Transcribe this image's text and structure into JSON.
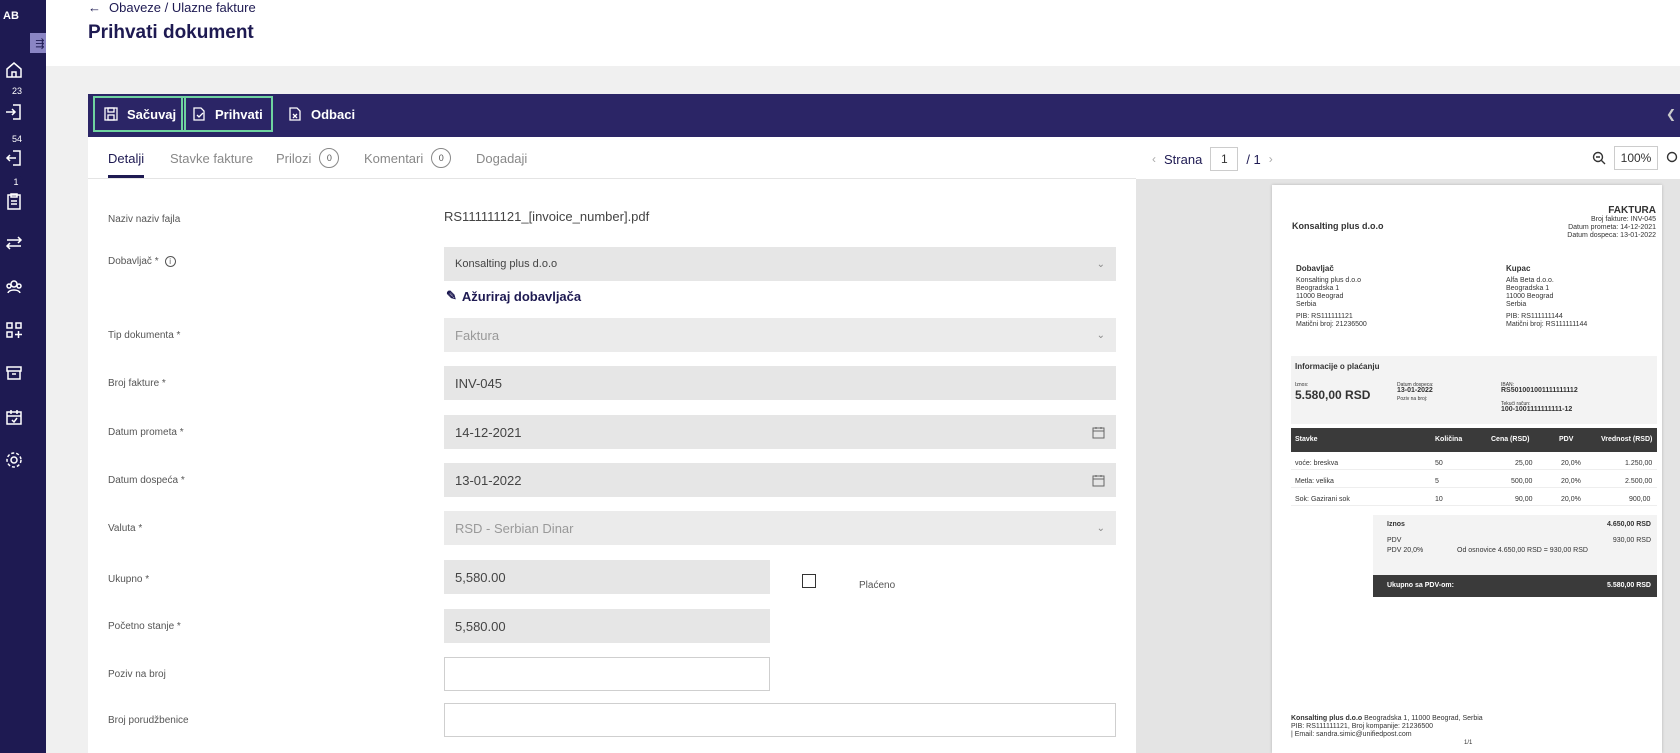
{
  "sidebar": {
    "avatar": "AB",
    "toggle_icon": "collapse-icon",
    "items": [
      {
        "name": "home-icon",
        "badge": ""
      },
      {
        "name": "inbox-incoming-icon",
        "badge": "23"
      },
      {
        "name": "outgoing-icon",
        "badge": "54"
      },
      {
        "name": "clipboard-icon",
        "badge": "1"
      },
      {
        "name": "transfer-icon",
        "badge": ""
      },
      {
        "name": "users-icon",
        "badge": ""
      },
      {
        "name": "apps-add-icon",
        "badge": ""
      },
      {
        "name": "archive-icon",
        "badge": ""
      },
      {
        "name": "calendar-sync-icon",
        "badge": ""
      },
      {
        "name": "settings-icon",
        "badge": ""
      }
    ]
  },
  "header": {
    "breadcrumb": "Obaveze / Ulazne fakture",
    "title": "Prihvati dokument"
  },
  "toolbar": {
    "save_label": "Sačuvaj",
    "accept_label": "Prihvati",
    "reject_label": "Odbaci"
  },
  "tabs": [
    {
      "label": "Detalji",
      "count": ""
    },
    {
      "label": "Stavke fakture",
      "count": ""
    },
    {
      "label": "Prilozi",
      "count": "0"
    },
    {
      "label": "Komentari",
      "count": "0"
    },
    {
      "label": "Dogadaji",
      "count": ""
    }
  ],
  "form": {
    "file_name": {
      "label": "Naziv naziv fajla",
      "value": "RS111111121_[invoice_number].pdf"
    },
    "supplier": {
      "label": "Dobavljač *",
      "value": "Konsalting plus d.o.o"
    },
    "update_supplier": "Ažuriraj dobavljača",
    "doc_type": {
      "label": "Tip dokumenta *",
      "value": "Faktura"
    },
    "invoice_number": {
      "label": "Broj fakture *",
      "value": "INV-045"
    },
    "turnover_date": {
      "label": "Datum prometa *",
      "value": "14-12-2021"
    },
    "due_date": {
      "label": "Datum dospeća *",
      "value": "13-01-2022"
    },
    "currency": {
      "label": "Valuta *",
      "value": "RSD - Serbian Dinar"
    },
    "total": {
      "label": "Ukupno *",
      "value": "5,580.00"
    },
    "paid_label": "Plaćeno",
    "opening_balance": {
      "label": "Početno stanje *",
      "value": "5,580.00"
    },
    "reference_number": {
      "label": "Poziv na broj",
      "value": ""
    },
    "order_number": {
      "label": "Broj porudžbenice",
      "value": ""
    }
  },
  "viewer": {
    "page_label": "Strana",
    "page_current": "1",
    "page_total": "/ 1",
    "zoom": "100%"
  },
  "invoice": {
    "title": "FAKTURA",
    "number_line": "Broj fakture: INV-045",
    "turnover_line": "Datum prometa: 14-12-2021",
    "due_line": "Datum dospeca: 13-01-2022",
    "company": "Konsalting plus d.o.o",
    "supplier_heading": "Dobavljač",
    "supplier_lines": [
      "Konsalting plus d.o.o",
      "Beogradska 1",
      "11000 Beograd",
      "Serbia"
    ],
    "supplier_pib": "PIB: RS111111121",
    "supplier_mb": "Matični broj: 21236500",
    "buyer_heading": "Kupac",
    "buyer_lines": [
      "Alfa Beta d.o.o.",
      "Beogradska 1",
      "11000 Beograd",
      "Serbia"
    ],
    "buyer_pib": "PIB: RS111111144",
    "buyer_mb": "Matični broj: RS111111144",
    "payment_heading": "Informacije o plaćanju",
    "amount_label": "Iznos:",
    "amount": "5.580,00 RSD",
    "due_label": "Datum dospeca:",
    "due_value": "13-01-2022",
    "ref_label": "Poziv na broj:",
    "iban_label": "IBAN:",
    "iban_value": "RS501001001111111112",
    "account_label": "Tekući račun:",
    "account_value": "100-1001111111111-12",
    "columns": [
      "Stavke",
      "Količina",
      "Cena (RSD)",
      "PDV",
      "Vrednost (RSD)"
    ],
    "rows": [
      [
        "voće: breskva",
        "50",
        "25,00",
        "20,0%",
        "1.250,00"
      ],
      [
        "Metla: velika",
        "5",
        "500,00",
        "20,0%",
        "2.500,00"
      ],
      [
        "Sok: Gazirani sok",
        "10",
        "90,00",
        "20,0%",
        "900,00"
      ]
    ],
    "sum_label": "Iznos",
    "sum_value": "4.650,00 RSD",
    "vat_label": "PDV",
    "vat_value": "930,00 RSD",
    "vat_rate": "PDV 20,0%",
    "vat_note": "Od osnovice 4.650,00 RSD = 930,00 RSD",
    "grand_label": "Ukupno sa PDV-om:",
    "grand_value": "5.580,00 RSD",
    "footer_company": "Konsalting plus d.o.o",
    "footer_address": "Beogradska 1, 11000 Beograd, Serbia",
    "footer_line2": "PIB: RS111111121, Broj kompanije: 21236500",
    "footer_line3": "| Email: sandra.simic@unifiedpost.com",
    "page_footer": "1/1"
  }
}
